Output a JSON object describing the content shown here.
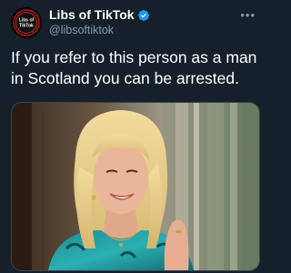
{
  "author": {
    "display_name": "Libs of TikTok",
    "handle": "@libsoftiktok",
    "avatar_text": "Libs of TikTok",
    "verified_icon": "verified-badge-icon",
    "more_icon": "more-options-icon"
  },
  "tweet": {
    "text": "If you refer to this person as a man in Scotland you can be arrested."
  },
  "colors": {
    "background": "#15202b",
    "verified": "#1d9bf0",
    "secondary_text": "#8b98a5"
  }
}
